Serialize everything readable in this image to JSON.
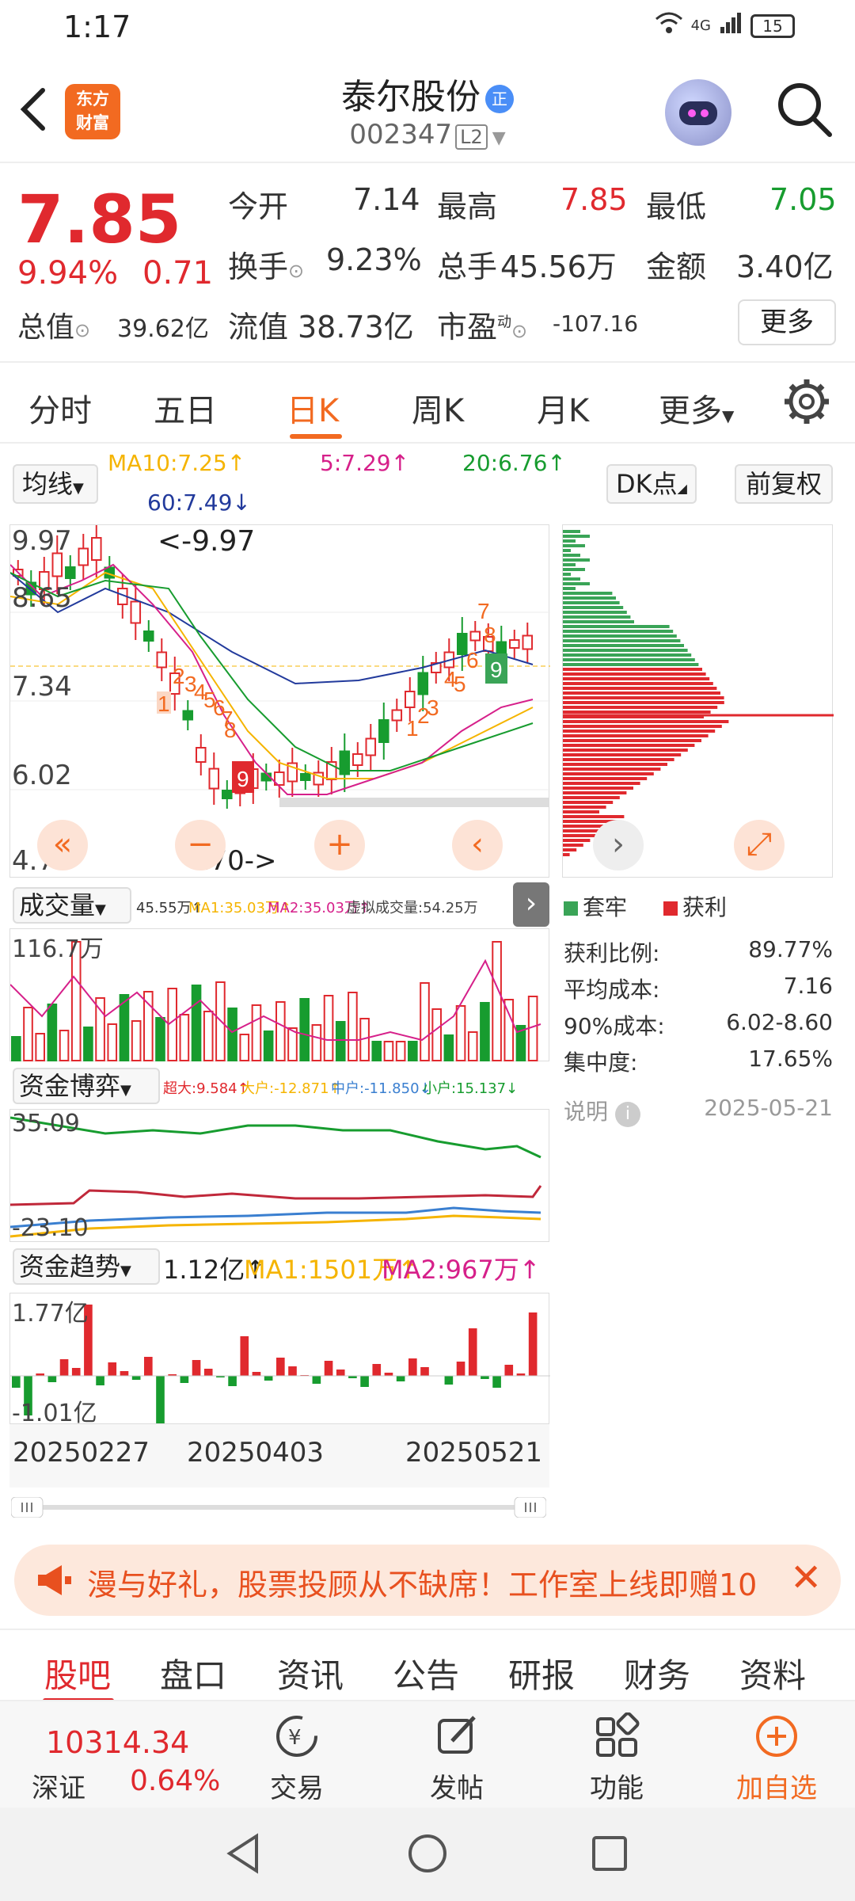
{
  "status": {
    "time": "1:17",
    "network": "4G",
    "battery": "15"
  },
  "header": {
    "logo_line1": "东方",
    "logo_line2": "财富",
    "stock_name": "泰尔股份",
    "badge": "正",
    "stock_code": "002347",
    "level": "L2"
  },
  "quote": {
    "price": "7.85",
    "change_pct": "9.94%",
    "change": "0.71",
    "open_label": "今开",
    "open": "7.14",
    "high_label": "最高",
    "high": "7.85",
    "low_label": "最低",
    "low": "7.05",
    "turnover_label": "换手",
    "turnover": "9.23%",
    "volume_label": "总手",
    "volume": "45.56万",
    "amount_label": "金额",
    "amount": "3.40亿",
    "total_mv_label": "总值",
    "total_mv": "39.62亿",
    "float_mv_label": "流值",
    "float_mv": "38.73亿",
    "pe_label": "市盈",
    "pe_sup": "动",
    "pe": "-107.16",
    "more_label": "更多"
  },
  "tabs": [
    "分时",
    "五日",
    "日K",
    "周K",
    "月K",
    "更多"
  ],
  "active_tab": "日K",
  "kline": {
    "indicator": "均线",
    "ma10": "MA10:7.25↑",
    "ma5": "5:7.29↑",
    "ma20": "20:6.76↑",
    "ma60": "60:7.49↓",
    "dk_label": "DK点",
    "fq_label": "前复权",
    "y_ticks": [
      "9.97",
      "8.65",
      "7.34",
      "6.02",
      "4.70"
    ],
    "max_marker": "<-9.97",
    "min_marker": "4.70->"
  },
  "volume": {
    "select": "成交量",
    "line": [
      "45.55万↑",
      "MA1:35.03万↑",
      "MA2:35.03万↑",
      "虚拟成交量:54.25万"
    ],
    "y_top": "116.7万"
  },
  "fund_game": {
    "select": "资金博弈",
    "line": [
      "超大:9.584↑",
      "大户:-12.871↑",
      "中户:-11.850↓",
      "小户:15.137↓"
    ],
    "y_top": "35.09",
    "y_bottom": "-23.10"
  },
  "fund_trend": {
    "select": "资金趋势",
    "line": [
      "1.12亿↑",
      "MA1:1501万↑",
      "MA2:967万↑"
    ],
    "y_top": "1.77亿",
    "y_bottom": "-1.01亿"
  },
  "dates": [
    "20250227",
    "20250403",
    "20250521"
  ],
  "chips": {
    "legend_trapped": "套牢",
    "legend_profit": "获利",
    "rows": [
      {
        "label": "获利比例:",
        "value": "89.77%"
      },
      {
        "label": "平均成本:",
        "value": "7.16"
      },
      {
        "label": "90%成本:",
        "value": "6.02-8.60"
      },
      {
        "label": "集中度:",
        "value": "17.65%"
      }
    ],
    "note_label": "说明",
    "date": "2025-05-21"
  },
  "promo": {
    "text": "漫与好礼，股票投顾从不缺席！工作室上线即赠10"
  },
  "bottom_tabs": [
    "股吧",
    "盘口",
    "资讯",
    "公告",
    "研报",
    "财务",
    "资料"
  ],
  "actionbar": {
    "index_value": "10314.34",
    "index_name": "深证",
    "index_pct": "0.64%",
    "actions": [
      "交易",
      "发帖",
      "功能",
      "加自选"
    ]
  },
  "colors": {
    "red": "#e0292e",
    "green": "#179c2f",
    "orange": "#f26a21",
    "ma10": "#f5b400",
    "ma5": "#d6208a",
    "ma20": "#179c2f",
    "ma60": "#223a9c"
  }
}
